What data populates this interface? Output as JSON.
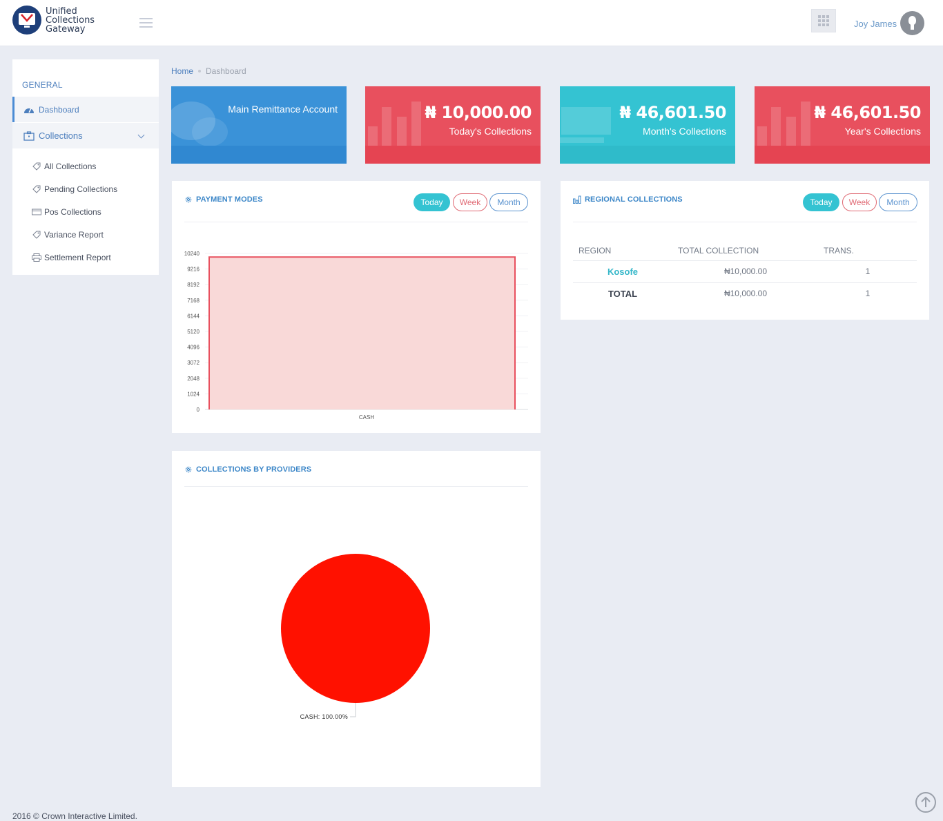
{
  "app": {
    "logo_line1": "Unified",
    "logo_line2": "Collections",
    "logo_line3": "Gateway"
  },
  "header": {
    "username": "Joy James"
  },
  "sidebar": {
    "heading": "GENERAL",
    "dashboard_label": "Dashboard",
    "collections_label": "Collections",
    "sub_items": [
      {
        "label": "All Collections",
        "icon": "tag-icon"
      },
      {
        "label": "Pending Collections",
        "icon": "tag-icon"
      },
      {
        "label": "Pos Collections",
        "icon": "card-icon"
      },
      {
        "label": "Variance Report",
        "icon": "tag-icon"
      },
      {
        "label": "Settlement Report",
        "icon": "printer-icon"
      }
    ]
  },
  "breadcrumb": {
    "home": "Home",
    "current": "Dashboard"
  },
  "cards": {
    "main": {
      "title": "Main Remittance Account",
      "color": "#3a92d8"
    },
    "today": {
      "amount": "₦ 10,000.00",
      "label": "Today's Collections",
      "color": "#e8505e"
    },
    "month": {
      "amount": "₦ 46,601.50",
      "label": "Month's Collections",
      "color": "#34c3d2"
    },
    "year": {
      "amount": "₦ 46,601.50",
      "label": "Year's Collections",
      "color": "#e8505e"
    }
  },
  "payment_modes": {
    "title": "PAYMENT MODES",
    "filters": {
      "today": "Today",
      "week": "Week",
      "month": "Month"
    }
  },
  "regional": {
    "title": "REGIONAL COLLECTIONS",
    "filters": {
      "today": "Today",
      "week": "Week",
      "month": "Month"
    },
    "columns": {
      "region": "REGION",
      "total": "TOTAL COLLECTION",
      "trans": "TRANS."
    },
    "rows": [
      {
        "region": "Kosofe",
        "total": "₦10,000.00",
        "trans": "1"
      }
    ],
    "total_row": {
      "label": "TOTAL",
      "total": "₦10,000.00",
      "trans": "1"
    }
  },
  "providers": {
    "title": "COLLECTIONS BY PROVIDERS"
  },
  "footer": {
    "text": "2016 © Crown Interactive Limited."
  },
  "chart_data": [
    {
      "type": "bar",
      "categories": [
        "CASH"
      ],
      "values": [
        10000
      ],
      "ylim": [
        0,
        10240
      ],
      "yticks": [
        0,
        1024,
        2048,
        3072,
        4096,
        5120,
        6144,
        7168,
        8192,
        9216,
        10240
      ],
      "color": "#e8505e",
      "fill": "#f9d9d8"
    },
    {
      "type": "pie",
      "slices": [
        {
          "label": "CASH",
          "value": 100.0,
          "display": "CASH: 100.00%",
          "color": "#ff1100"
        }
      ]
    }
  ]
}
